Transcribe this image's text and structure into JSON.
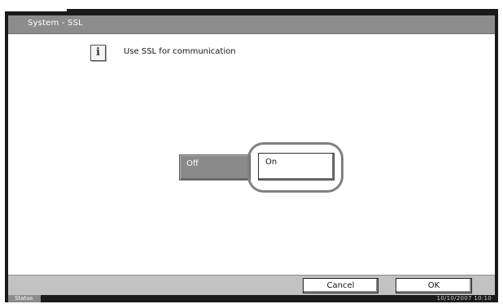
{
  "window": {
    "title": "System - SSL"
  },
  "info": {
    "icon": "info-icon",
    "glyph": "i",
    "message": "Use SSL for communication"
  },
  "options": {
    "off_label": "Off",
    "on_label": "On",
    "selected": "On"
  },
  "footer": {
    "cancel_label": "Cancel",
    "ok_label": "OK"
  },
  "status": {
    "label": "Status",
    "datetime": "10/10/2007   10:10"
  },
  "colors": {
    "frame": "#1a1a1a",
    "title_bar": "#8c8c8c",
    "off_button": "#8a8a8a",
    "on_button": "#ffffff",
    "bottom_bar": "#c2c2c2"
  }
}
